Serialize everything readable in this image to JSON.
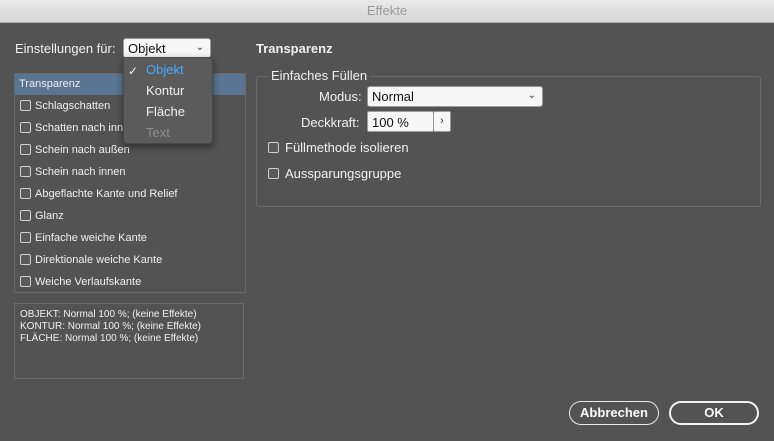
{
  "window": {
    "title": "Effekte"
  },
  "settings_for": {
    "label": "Einstellungen für:",
    "selected": "Objekt",
    "options": [
      {
        "label": "Objekt",
        "state": "selected"
      },
      {
        "label": "Kontur",
        "state": "normal"
      },
      {
        "label": "Fläche",
        "state": "normal"
      },
      {
        "label": "Text",
        "state": "disabled"
      }
    ]
  },
  "effects_list": [
    {
      "label": "Transparenz",
      "active": true
    },
    {
      "label": "Schlagschatten",
      "checked": false
    },
    {
      "label": "Schatten nach innen",
      "checked": false
    },
    {
      "label": "Schein nach außen",
      "checked": false
    },
    {
      "label": "Schein nach innen",
      "checked": false
    },
    {
      "label": "Abgeflachte Kante und Relief",
      "checked": false
    },
    {
      "label": "Glanz",
      "checked": false
    },
    {
      "label": "Einfache weiche Kante",
      "checked": false
    },
    {
      "label": "Direktionale weiche Kante",
      "checked": false
    },
    {
      "label": "Weiche Verlaufskante",
      "checked": false
    }
  ],
  "summary": {
    "lines": [
      "OBJEKT: Normal 100 %; (keine Effekte)",
      "KONTUR: Normal 100 %; (keine Effekte)",
      "FLÄCHE: Normal 100 %; (keine Effekte)"
    ]
  },
  "panel": {
    "title": "Transparenz",
    "group_title": "Einfaches Füllen",
    "mode_label": "Modus:",
    "mode_value": "Normal",
    "opacity_label": "Deckkraft:",
    "opacity_value": "100 %",
    "isolate_label": "Füllmethode isolieren",
    "isolate_checked": false,
    "knockout_label": "Aussparungsgruppe",
    "knockout_checked": false
  },
  "buttons": {
    "cancel": "Abbrechen",
    "ok": "OK"
  }
}
